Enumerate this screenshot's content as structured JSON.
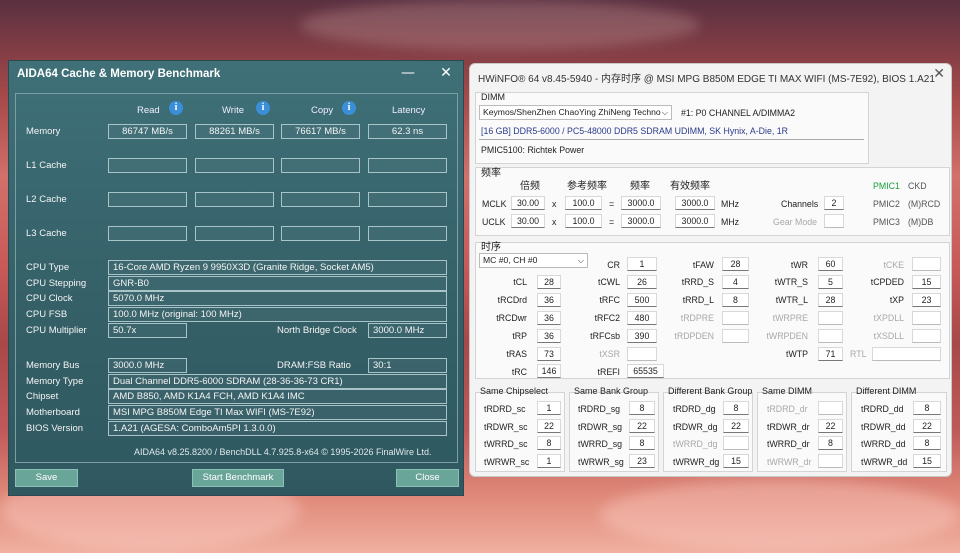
{
  "aida": {
    "title": "AIDA64 Cache & Memory Benchmark",
    "minimize": "—",
    "close": "✕",
    "headers": {
      "read": "Read",
      "write": "Write",
      "copy": "Copy",
      "latency": "Latency"
    },
    "rows": [
      {
        "label": "Memory",
        "read": "86747 MB/s",
        "write": "88261 MB/s",
        "copy": "76617 MB/s",
        "latency": "62.3 ns"
      },
      {
        "label": "L1 Cache",
        "read": "",
        "write": "",
        "copy": "",
        "latency": ""
      },
      {
        "label": "L2 Cache",
        "read": "",
        "write": "",
        "copy": "",
        "latency": ""
      },
      {
        "label": "L3 Cache",
        "read": "",
        "write": "",
        "copy": "",
        "latency": ""
      }
    ],
    "cpu": {
      "type_label": "CPU Type",
      "type": "16-Core AMD Ryzen 9 9950X3D  (Granite Ridge, Socket AM5)",
      "stepping_label": "CPU Stepping",
      "stepping": "GNR-B0",
      "clock_label": "CPU Clock",
      "clock": "5070.0 MHz",
      "fsb_label": "CPU FSB",
      "fsb": "100.0 MHz  (original: 100 MHz)",
      "mult_label": "CPU Multiplier",
      "mult": "50.7x",
      "nb_label": "North Bridge Clock",
      "nb": "3000.0 MHz"
    },
    "mem": {
      "bus_label": "Memory Bus",
      "bus": "3000.0 MHz",
      "ratio_label": "DRAM:FSB Ratio",
      "ratio": "30:1",
      "type_label": "Memory Type",
      "type": "Dual Channel DDR5-6000 SDRAM  (28-36-36-73 CR1)",
      "chipset_label": "Chipset",
      "chipset": "AMD B850, AMD K1A4 FCH, AMD K1A4 IMC",
      "mb_label": "Motherboard",
      "mb": "MSI MPG B850M Edge TI Max WIFI (MS-7E92)",
      "bios_label": "BIOS Version",
      "bios": "1.A21  (AGESA: ComboAm5PI 1.3.0.0)"
    },
    "footer": "AIDA64 v8.25.8200 / BenchDLL 4.7.925.8-x64  © 1995-2026 FinalWire Ltd.",
    "buttons": {
      "save": "Save",
      "start": "Start Benchmark",
      "close": "Close"
    }
  },
  "hw": {
    "title": "HWiNFO® 64 v8.45-5940 - 内存时序 @ MSI MPG B850M EDGE TI MAX WIFI (MS-7E92), BIOS 1.A21",
    "close": "✕",
    "dimm_group": "DIMM",
    "vendor": "Keymos/ShenZhen ChaoYing ZhiNeng Techno",
    "slot": "#1: P0 CHANNEL A/DIMMA2",
    "module": "[16 GB] DDR5-6000 / PC5-48000 DDR5 SDRAM UDIMM, SK Hynix, A-Die, 1R",
    "pmic": "PMIC5100: Richtek Power",
    "freq_group": "频率",
    "freq_headers": {
      "mult": "倍频",
      "ref": "参考频率",
      "freq": "频率",
      "eff": "有效频率"
    },
    "mclk": {
      "label": "MCLK",
      "mult": "30.00",
      "x": "x",
      "ref": "100.0",
      "eq": "=",
      "freq": "3000.0",
      "eff": "3000.0",
      "unit": "MHz"
    },
    "uclk": {
      "label": "UCLK",
      "mult": "30.00",
      "x": "x",
      "ref": "100.0",
      "eq": "=",
      "freq": "3000.0",
      "eff": "3000.0",
      "unit": "MHz"
    },
    "channels_label": "Channels",
    "channels": "2",
    "gear_label": "Gear Mode",
    "pmic1": "PMIC1",
    "pmic1v": "CKD",
    "pmic2": "PMIC2",
    "pmic2v": "(M)RCD",
    "pmic3": "PMIC3",
    "pmic3v": "(M)DB",
    "timing_group": "时序",
    "mc": "MC #0, CH #0",
    "timings": {
      "CR": "1",
      "tFAW": "28",
      "tWR": "60",
      "tCKE": "",
      "tCL": "28",
      "tCWL": "26",
      "tRRD_S": "4",
      "tWTR_S": "5",
      "tCPDED": "15",
      "tRCDrd": "36",
      "tRFC": "500",
      "tRRD_L": "8",
      "tWTR_L": "28",
      "tXP": "23",
      "tRCDwr": "36",
      "tRFC2": "480",
      "tRDPRE": "",
      "tWRPRE": "",
      "tXPDLL": "",
      "tRP": "36",
      "tRFCsb": "390",
      "tRDPDEN": "",
      "tWRPDEN": "",
      "tXSDLL": "",
      "tRAS": "73",
      "tXSR": "",
      "tWTP": "71",
      "RTL": "",
      "tRC": "146",
      "tREFI": "65535"
    },
    "groups": {
      "sc": {
        "title": "Same Chipselect",
        "rows": [
          [
            "tRDRD_sc",
            "1"
          ],
          [
            "tRDWR_sc",
            "22"
          ],
          [
            "tWRRD_sc",
            "8"
          ],
          [
            "tWRWR_sc",
            "1"
          ]
        ]
      },
      "sg": {
        "title": "Same Bank Group",
        "rows": [
          [
            "tRDRD_sg",
            "8"
          ],
          [
            "tRDWR_sg",
            "22"
          ],
          [
            "tWRRD_sg",
            "8"
          ],
          [
            "tWRWR_sg",
            "23"
          ]
        ]
      },
      "dg": {
        "title": "Different Bank Group",
        "rows": [
          [
            "tRDRD_dg",
            "8"
          ],
          [
            "tRDWR_dg",
            "22"
          ],
          [
            "tWRRD_dg",
            ""
          ],
          [
            "tWRWR_dg",
            "15"
          ]
        ]
      },
      "sd": {
        "title": "Same DIMM",
        "rows": [
          [
            "tRDRD_dr",
            ""
          ],
          [
            "tRDWR_dr",
            "22"
          ],
          [
            "tWRRD_dr",
            "8"
          ],
          [
            "tWRWR_dr",
            ""
          ]
        ]
      },
      "dd": {
        "title": "Different DIMM",
        "rows": [
          [
            "tRDRD_dd",
            "8"
          ],
          [
            "tRDWR_dd",
            "22"
          ],
          [
            "tWRRD_dd",
            "8"
          ],
          [
            "tWRWR_dd",
            "15"
          ]
        ]
      }
    }
  }
}
